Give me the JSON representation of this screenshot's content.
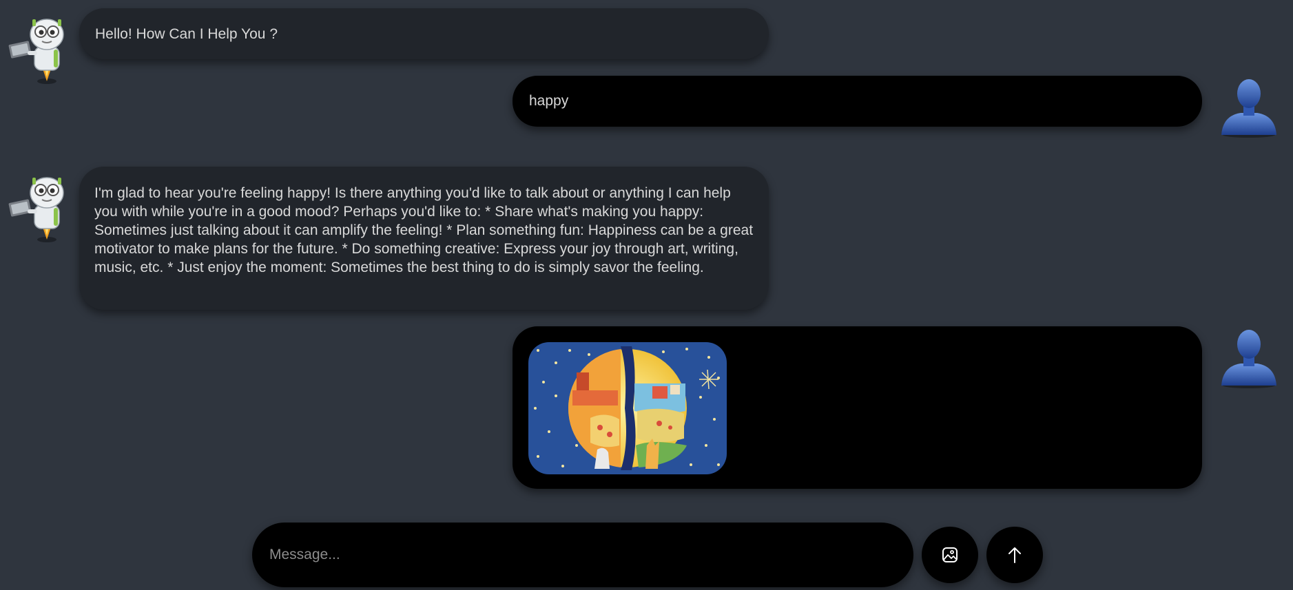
{
  "messages": [
    {
      "role": "bot",
      "text": "Hello! How Can I Help You ?"
    },
    {
      "role": "user",
      "text": "happy"
    },
    {
      "role": "bot",
      "text": "I'm glad to hear you're feeling happy! Is there anything you'd like to talk about or anything I can help you with while you're in a good mood? Perhaps you'd like to: * Share what's making you happy: Sometimes just talking about it can amplify the feeling! * Plan something fun: Happiness can be a great motivator to make plans for the future. * Do something creative: Express your joy through art, writing, music, etc. * Just enjoy the moment: Sometimes the best thing to do is simply savor the feeling."
    },
    {
      "role": "user",
      "attachment_icon": "painting-image"
    }
  ],
  "composer": {
    "placeholder": "Message...",
    "value": ""
  },
  "icons": {
    "bot_avatar": "robot-avatar-icon",
    "user_avatar": "user-avatar-icon",
    "image_upload": "image-upload-icon",
    "send": "arrow-up-icon"
  },
  "colors": {
    "background": "#2f353e",
    "bot_bubble": "#21252b",
    "user_bubble": "#000000",
    "text": "#d9d9d9",
    "placeholder": "#8c8c8c"
  }
}
